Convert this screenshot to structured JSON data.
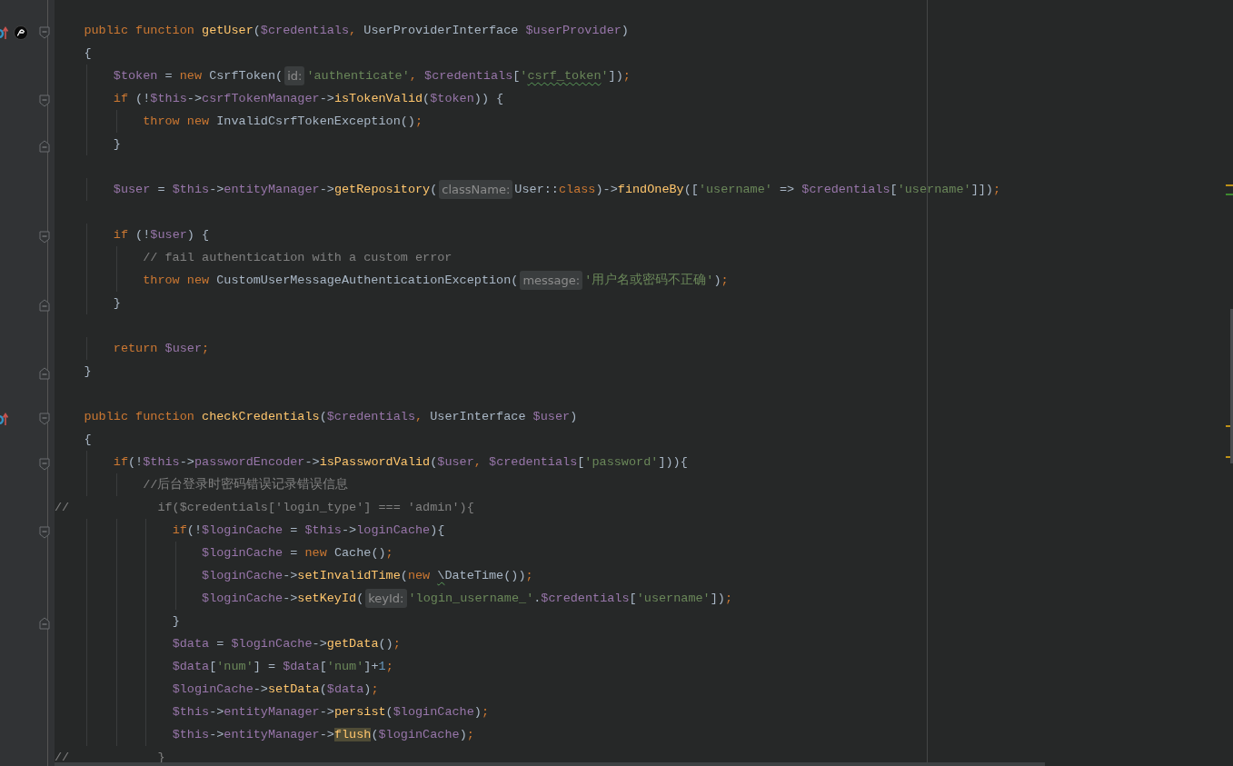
{
  "lines": [
    {
      "kind": "code",
      "gutter_icons": [
        {
          "kind": "override"
        },
        {
          "kind": "symfony"
        }
      ],
      "fold": {
        "kind": "start"
      },
      "tokens": [
        {
          "kind": "keyword",
          "text": "    public function "
        },
        {
          "kind": "function",
          "text": "getUser"
        },
        {
          "kind": "plain",
          "text": "("
        },
        {
          "kind": "variable",
          "text": "$credentials"
        },
        {
          "kind": "punct",
          "text": ", "
        },
        {
          "kind": "plain",
          "text": "UserProviderInterface "
        },
        {
          "kind": "variable",
          "text": "$userProvider"
        },
        {
          "kind": "plain",
          "text": ")"
        }
      ]
    },
    {
      "kind": "code",
      "tokens": [
        {
          "kind": "plain",
          "text": "    {"
        }
      ]
    },
    {
      "kind": "code",
      "tokens": [
        {
          "kind": "variable",
          "text": "        $token"
        },
        {
          "kind": "plain",
          "text": " = "
        },
        {
          "kind": "keyword",
          "text": "new "
        },
        {
          "kind": "plain",
          "text": "CsrfToken("
        },
        {
          "kind": "hint",
          "text": "id:"
        },
        {
          "kind": "string",
          "text": "'authenticate'"
        },
        {
          "kind": "punct",
          "text": ", "
        },
        {
          "kind": "variable",
          "text": "$credentials"
        },
        {
          "kind": "plain",
          "text": "["
        },
        {
          "kind": "string",
          "text": "'"
        },
        {
          "kind": "string",
          "text": "csrf_token",
          "typo": true
        },
        {
          "kind": "string",
          "text": "'"
        },
        {
          "kind": "plain",
          "text": "])"
        },
        {
          "kind": "punct",
          "text": ";"
        }
      ]
    },
    {
      "kind": "code",
      "fold": {
        "kind": "start"
      },
      "tokens": [
        {
          "kind": "keyword",
          "text": "        if"
        },
        {
          "kind": "plain",
          "text": " (!"
        },
        {
          "kind": "variable",
          "text": "$this"
        },
        {
          "kind": "plain",
          "text": "->"
        },
        {
          "kind": "variable",
          "text": "csrfTokenManager"
        },
        {
          "kind": "plain",
          "text": "->"
        },
        {
          "kind": "function",
          "text": "isTokenValid"
        },
        {
          "kind": "plain",
          "text": "("
        },
        {
          "kind": "variable",
          "text": "$token"
        },
        {
          "kind": "plain",
          "text": ")) {"
        }
      ]
    },
    {
      "kind": "code",
      "tokens": [
        {
          "kind": "keyword",
          "text": "            throw new "
        },
        {
          "kind": "plain",
          "text": "InvalidCsrfTokenException()"
        },
        {
          "kind": "punct",
          "text": ";"
        }
      ]
    },
    {
      "kind": "code",
      "fold": {
        "kind": "end"
      },
      "tokens": [
        {
          "kind": "plain",
          "text": "        }"
        }
      ]
    },
    {
      "kind": "blank"
    },
    {
      "kind": "code",
      "tokens": [
        {
          "kind": "variable",
          "text": "        $user"
        },
        {
          "kind": "plain",
          "text": " = "
        },
        {
          "kind": "variable",
          "text": "$this"
        },
        {
          "kind": "plain",
          "text": "->"
        },
        {
          "kind": "variable",
          "text": "entityManager"
        },
        {
          "kind": "plain",
          "text": "->"
        },
        {
          "kind": "function",
          "text": "getRepository"
        },
        {
          "kind": "plain",
          "text": "("
        },
        {
          "kind": "hint",
          "text": "className:"
        },
        {
          "kind": "plain",
          "text": "User::"
        },
        {
          "kind": "keyword",
          "text": "class"
        },
        {
          "kind": "plain",
          "text": ")->"
        },
        {
          "kind": "function",
          "text": "findOneBy"
        },
        {
          "kind": "plain",
          "text": "(["
        },
        {
          "kind": "string",
          "text": "'username'"
        },
        {
          "kind": "plain",
          "text": " => "
        },
        {
          "kind": "variable",
          "text": "$credentials"
        },
        {
          "kind": "plain",
          "text": "["
        },
        {
          "kind": "string",
          "text": "'username'"
        },
        {
          "kind": "plain",
          "text": "]])"
        },
        {
          "kind": "punct",
          "text": ";"
        }
      ]
    },
    {
      "kind": "blank"
    },
    {
      "kind": "code",
      "fold": {
        "kind": "start"
      },
      "tokens": [
        {
          "kind": "keyword",
          "text": "        if"
        },
        {
          "kind": "plain",
          "text": " (!"
        },
        {
          "kind": "variable",
          "text": "$user"
        },
        {
          "kind": "plain",
          "text": ") {"
        }
      ]
    },
    {
      "kind": "code",
      "tokens": [
        {
          "kind": "comment",
          "text": "            // fail authentication with a custom error"
        }
      ]
    },
    {
      "kind": "code",
      "tokens": [
        {
          "kind": "keyword",
          "text": "            throw new "
        },
        {
          "kind": "plain",
          "text": "CustomUserMessageAuthenticationException("
        },
        {
          "kind": "hint",
          "text": "message:"
        },
        {
          "kind": "string",
          "text": "'用户名或密码不正确'"
        },
        {
          "kind": "plain",
          "text": ")"
        },
        {
          "kind": "punct",
          "text": ";"
        }
      ]
    },
    {
      "kind": "code",
      "fold": {
        "kind": "end"
      },
      "tokens": [
        {
          "kind": "plain",
          "text": "        }"
        }
      ]
    },
    {
      "kind": "blank"
    },
    {
      "kind": "code",
      "tokens": [
        {
          "kind": "keyword",
          "text": "        return "
        },
        {
          "kind": "variable",
          "text": "$user"
        },
        {
          "kind": "punct",
          "text": ";"
        }
      ]
    },
    {
      "kind": "code",
      "fold": {
        "kind": "end"
      },
      "tokens": [
        {
          "kind": "plain",
          "text": "    }"
        }
      ]
    },
    {
      "kind": "blank"
    },
    {
      "kind": "code",
      "gutter_icons": [
        {
          "kind": "override"
        }
      ],
      "fold": {
        "kind": "start"
      },
      "tokens": [
        {
          "kind": "keyword",
          "text": "    public function "
        },
        {
          "kind": "function",
          "text": "checkCredentials"
        },
        {
          "kind": "plain",
          "text": "("
        },
        {
          "kind": "variable",
          "text": "$credentials"
        },
        {
          "kind": "punct",
          "text": ", "
        },
        {
          "kind": "plain",
          "text": "UserInterface "
        },
        {
          "kind": "variable",
          "text": "$user"
        },
        {
          "kind": "plain",
          "text": ")"
        }
      ]
    },
    {
      "kind": "code",
      "tokens": [
        {
          "kind": "plain",
          "text": "    {"
        }
      ]
    },
    {
      "kind": "code",
      "fold": {
        "kind": "start"
      },
      "tokens": [
        {
          "kind": "keyword",
          "text": "        if"
        },
        {
          "kind": "plain",
          "text": "(!"
        },
        {
          "kind": "variable",
          "text": "$this"
        },
        {
          "kind": "plain",
          "text": "->"
        },
        {
          "kind": "variable",
          "text": "passwordEncoder"
        },
        {
          "kind": "plain",
          "text": "->"
        },
        {
          "kind": "function",
          "text": "isPasswordValid"
        },
        {
          "kind": "plain",
          "text": "("
        },
        {
          "kind": "variable",
          "text": "$user"
        },
        {
          "kind": "punct",
          "text": ", "
        },
        {
          "kind": "variable",
          "text": "$credentials"
        },
        {
          "kind": "plain",
          "text": "["
        },
        {
          "kind": "string",
          "text": "'password'"
        },
        {
          "kind": "plain",
          "text": "])){"
        }
      ]
    },
    {
      "kind": "code",
      "tokens": [
        {
          "kind": "comment",
          "text": "            //后台登录时密码错误记录错误信息"
        }
      ]
    },
    {
      "kind": "code",
      "tokens": [
        {
          "kind": "comment",
          "text": "//            if($credentials['login_type'] === 'admin'){"
        }
      ]
    },
    {
      "kind": "code",
      "fold": {
        "kind": "start"
      },
      "tokens": [
        {
          "kind": "keyword",
          "text": "                if"
        },
        {
          "kind": "plain",
          "text": "(!"
        },
        {
          "kind": "variable",
          "text": "$loginCache"
        },
        {
          "kind": "plain",
          "text": " = "
        },
        {
          "kind": "variable",
          "text": "$this"
        },
        {
          "kind": "plain",
          "text": "->"
        },
        {
          "kind": "variable",
          "text": "loginCache"
        },
        {
          "kind": "plain",
          "text": "){"
        }
      ]
    },
    {
      "kind": "code",
      "tokens": [
        {
          "kind": "variable",
          "text": "                    $loginCache"
        },
        {
          "kind": "plain",
          "text": " = "
        },
        {
          "kind": "keyword",
          "text": "new "
        },
        {
          "kind": "plain",
          "text": "Cache()"
        },
        {
          "kind": "punct",
          "text": ";"
        }
      ]
    },
    {
      "kind": "code",
      "tokens": [
        {
          "kind": "variable",
          "text": "                    $loginCache"
        },
        {
          "kind": "plain",
          "text": "->"
        },
        {
          "kind": "function",
          "text": "setInvalidTime"
        },
        {
          "kind": "plain",
          "text": "("
        },
        {
          "kind": "keyword",
          "text": "new "
        },
        {
          "kind": "plain",
          "text": "\\",
          "typo": true
        },
        {
          "kind": "plain",
          "text": "DateTime())"
        },
        {
          "kind": "punct",
          "text": ";"
        }
      ]
    },
    {
      "kind": "code",
      "tokens": [
        {
          "kind": "variable",
          "text": "                    $loginCache"
        },
        {
          "kind": "plain",
          "text": "->"
        },
        {
          "kind": "function",
          "text": "setKeyId"
        },
        {
          "kind": "plain",
          "text": "("
        },
        {
          "kind": "hint",
          "text": "keyId:"
        },
        {
          "kind": "string",
          "text": "'login_username_'"
        },
        {
          "kind": "plain",
          "text": "."
        },
        {
          "kind": "variable",
          "text": "$credentials"
        },
        {
          "kind": "plain",
          "text": "["
        },
        {
          "kind": "string",
          "text": "'username'"
        },
        {
          "kind": "plain",
          "text": "])"
        },
        {
          "kind": "punct",
          "text": ";"
        }
      ]
    },
    {
      "kind": "code",
      "fold": {
        "kind": "end"
      },
      "tokens": [
        {
          "kind": "plain",
          "text": "                }"
        }
      ]
    },
    {
      "kind": "code",
      "tokens": [
        {
          "kind": "variable",
          "text": "                $data"
        },
        {
          "kind": "plain",
          "text": " = "
        },
        {
          "kind": "variable",
          "text": "$loginCache"
        },
        {
          "kind": "plain",
          "text": "->"
        },
        {
          "kind": "function",
          "text": "getData"
        },
        {
          "kind": "plain",
          "text": "()"
        },
        {
          "kind": "punct",
          "text": ";"
        }
      ]
    },
    {
      "kind": "code",
      "tokens": [
        {
          "kind": "variable",
          "text": "                $data"
        },
        {
          "kind": "plain",
          "text": "["
        },
        {
          "kind": "string",
          "text": "'num'"
        },
        {
          "kind": "plain",
          "text": "] = "
        },
        {
          "kind": "variable",
          "text": "$data"
        },
        {
          "kind": "plain",
          "text": "["
        },
        {
          "kind": "string",
          "text": "'num'"
        },
        {
          "kind": "plain",
          "text": "]+"
        },
        {
          "kind": "number",
          "text": "1"
        },
        {
          "kind": "punct",
          "text": ";"
        }
      ]
    },
    {
      "kind": "code",
      "tokens": [
        {
          "kind": "variable",
          "text": "                $loginCache"
        },
        {
          "kind": "plain",
          "text": "->"
        },
        {
          "kind": "function",
          "text": "setData"
        },
        {
          "kind": "plain",
          "text": "("
        },
        {
          "kind": "variable",
          "text": "$data"
        },
        {
          "kind": "plain",
          "text": ")"
        },
        {
          "kind": "punct",
          "text": ";"
        }
      ]
    },
    {
      "kind": "code",
      "tokens": [
        {
          "kind": "variable",
          "text": "                $this"
        },
        {
          "kind": "plain",
          "text": "->"
        },
        {
          "kind": "variable",
          "text": "entityManager"
        },
        {
          "kind": "plain",
          "text": "->"
        },
        {
          "kind": "function",
          "text": "persist"
        },
        {
          "kind": "plain",
          "text": "("
        },
        {
          "kind": "variable",
          "text": "$loginCache"
        },
        {
          "kind": "plain",
          "text": ")"
        },
        {
          "kind": "punct",
          "text": ";"
        }
      ]
    },
    {
      "kind": "code",
      "tokens": [
        {
          "kind": "variable",
          "text": "                $this"
        },
        {
          "kind": "plain",
          "text": "->"
        },
        {
          "kind": "variable",
          "text": "entityManager"
        },
        {
          "kind": "plain",
          "text": "->"
        },
        {
          "kind": "function",
          "text": "flush",
          "highlighted": true
        },
        {
          "kind": "plain",
          "text": "("
        },
        {
          "kind": "variable",
          "text": "$loginCache"
        },
        {
          "kind": "plain",
          "text": ")"
        },
        {
          "kind": "punct",
          "text": ";"
        }
      ]
    },
    {
      "kind": "code",
      "tokens": [
        {
          "kind": "comment",
          "text": "//            }"
        }
      ]
    }
  ],
  "error_stripe": [
    {
      "color": "#be9117"
    },
    {
      "color": "#3d8a2f"
    },
    {
      "color": "#be9117"
    },
    {
      "color": "#be9117"
    }
  ]
}
